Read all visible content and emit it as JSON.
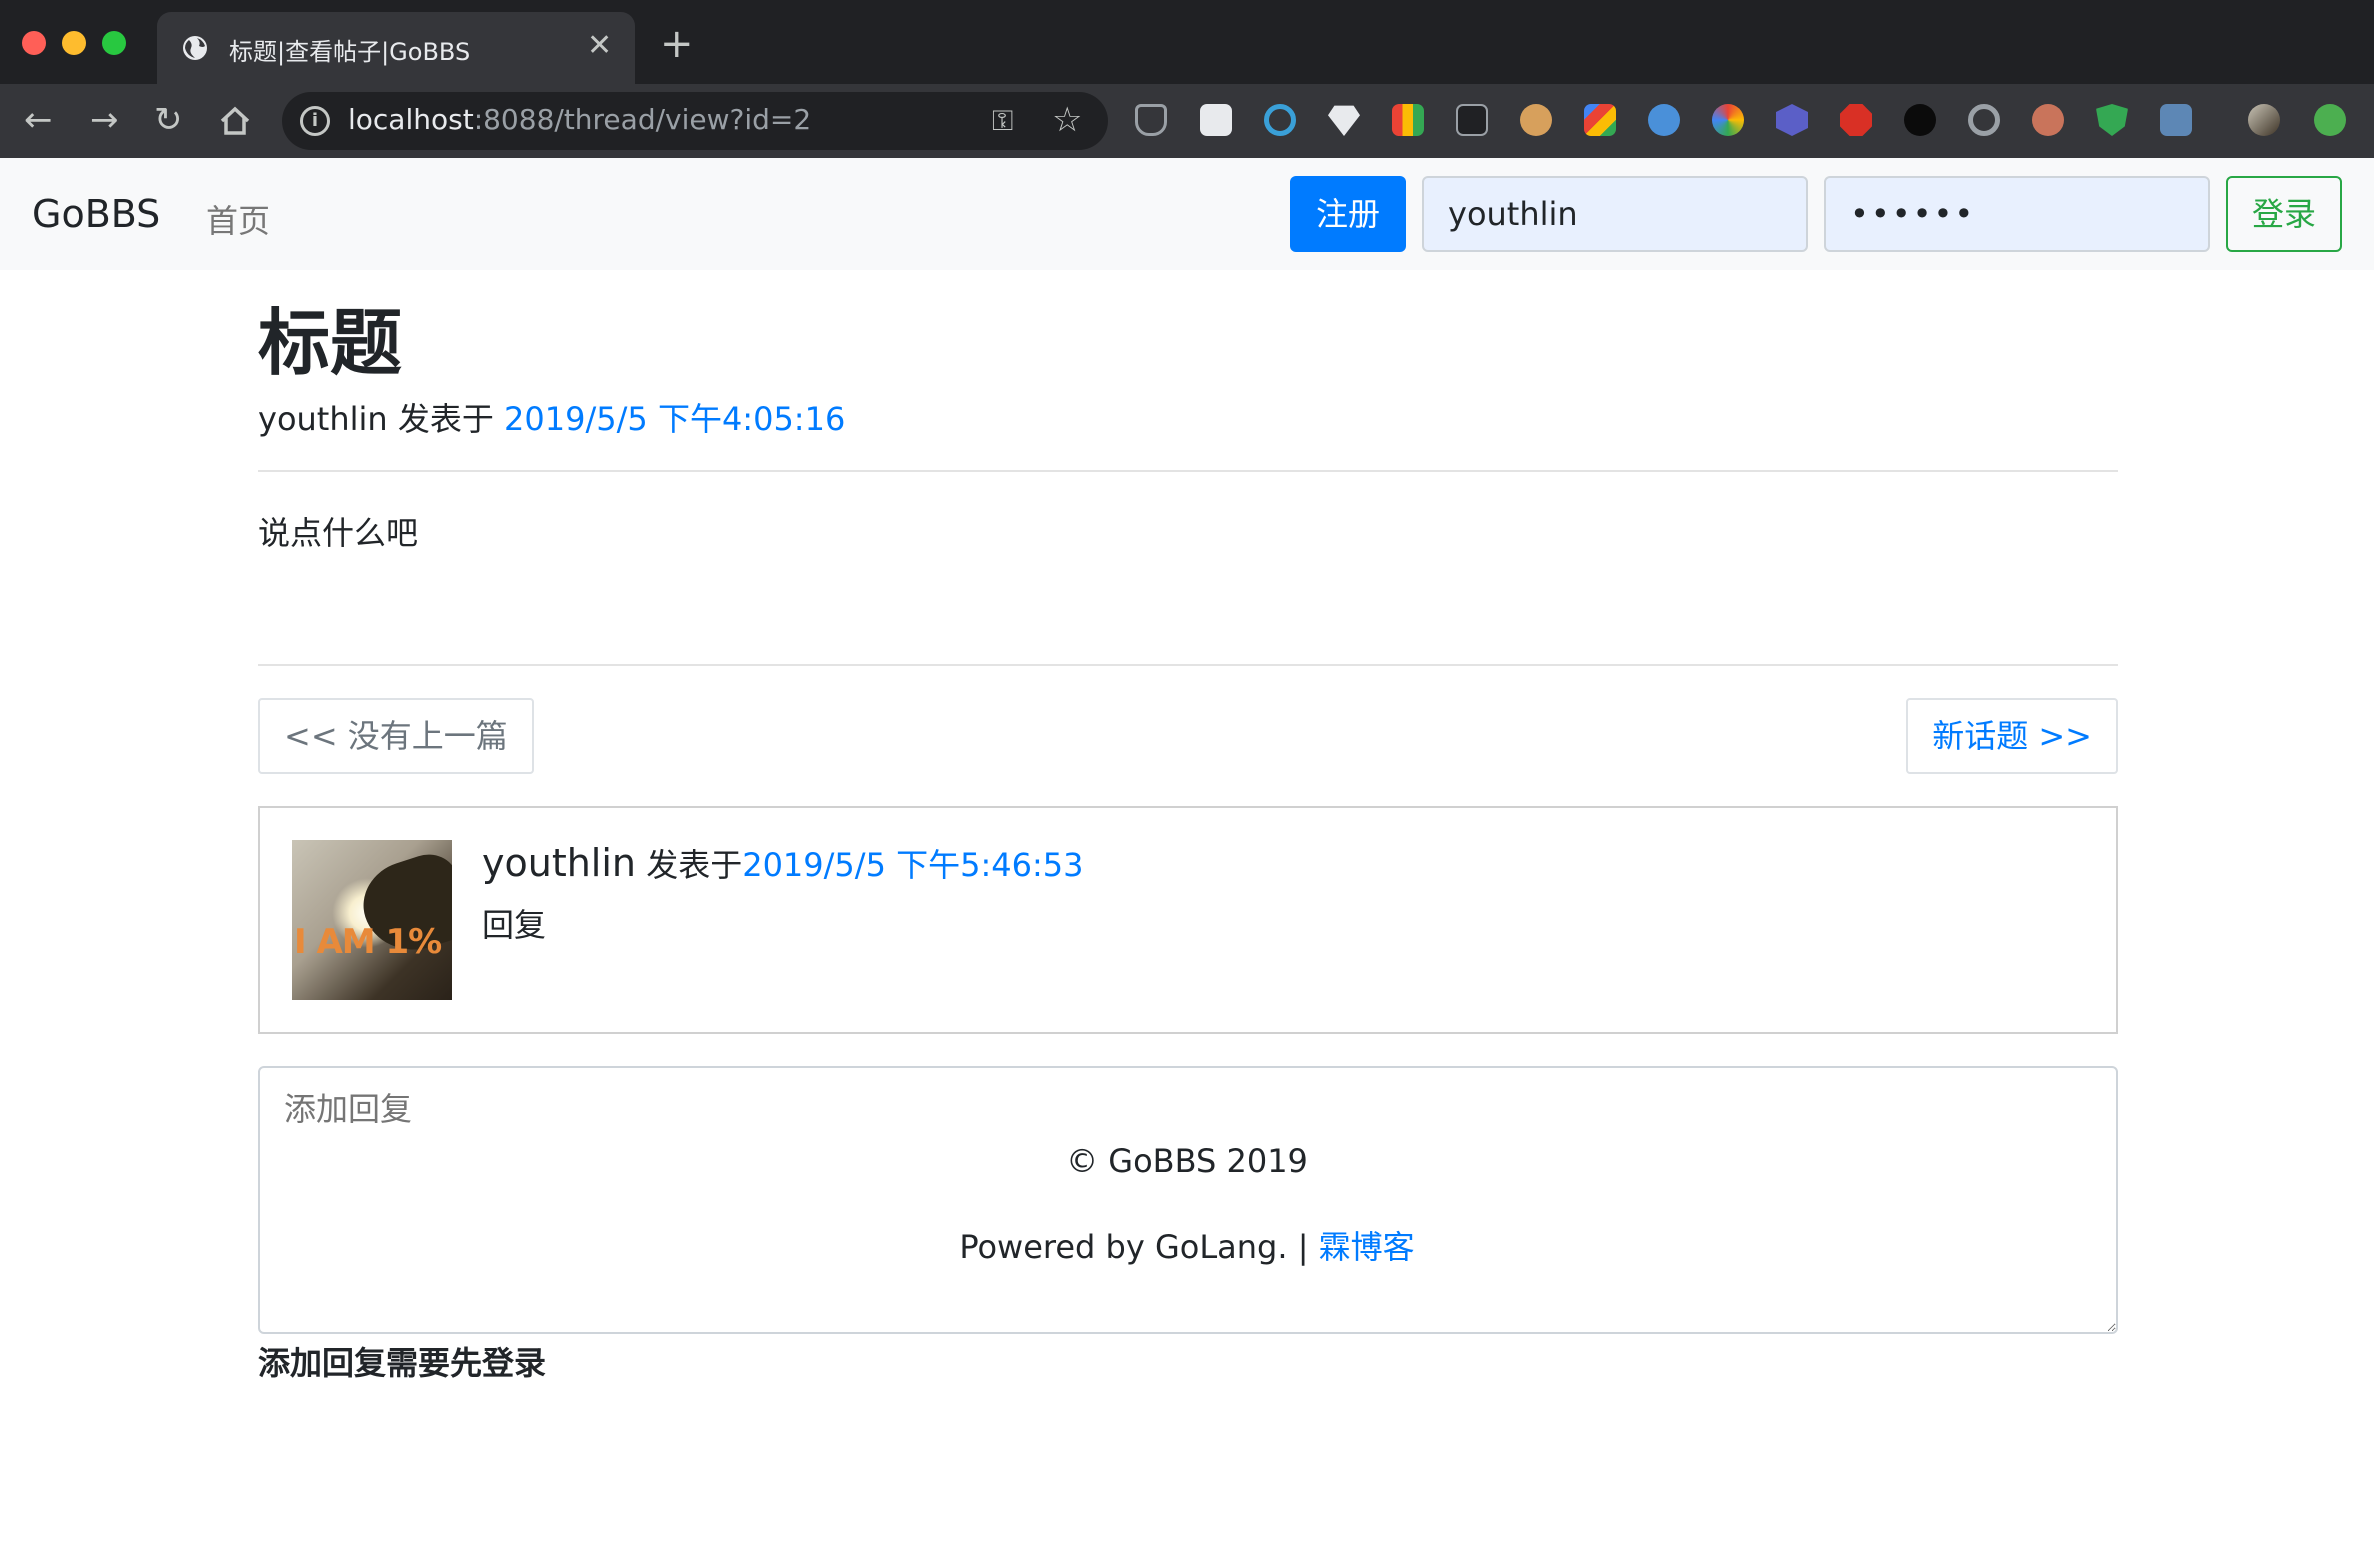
{
  "browser": {
    "tab_title": "标题|查看帖子|GoBBS",
    "url_host": "localhost",
    "url_rest": ":8088/thread/view?id=2",
    "new_tab": "+",
    "close": "✕",
    "colors": {
      "close": "#ff5f57",
      "minimize": "#febc2e",
      "zoom": "#28c840"
    }
  },
  "navbar": {
    "brand": "GoBBS",
    "home": "首页",
    "register": "注册",
    "username_value": "youthlin",
    "password_value": "••••••",
    "login": "登录"
  },
  "thread": {
    "title": "标题",
    "author": "youthlin",
    "posted_at_label": " 发表于 ",
    "posted_at": "2019/5/5 下午4:05:16",
    "body": "说点什么吧"
  },
  "pager": {
    "prev": "<< 没有上一篇",
    "next": "新话题 >>"
  },
  "replies": [
    {
      "user": "youthlin",
      "posted_label": " 发表于",
      "time": "2019/5/5 下午5:46:53",
      "text": "回复",
      "avatar_text": "I AM 1%"
    }
  ],
  "reply_form": {
    "placeholder": "添加回复",
    "login_hint": "添加回复需要先登录"
  },
  "footer": {
    "copyright": "© GoBBS 2019",
    "powered": "Powered by GoLang. | ",
    "blog_link": "霖博客"
  },
  "theme": {
    "primary": "#007bff",
    "success": "#28a745"
  }
}
